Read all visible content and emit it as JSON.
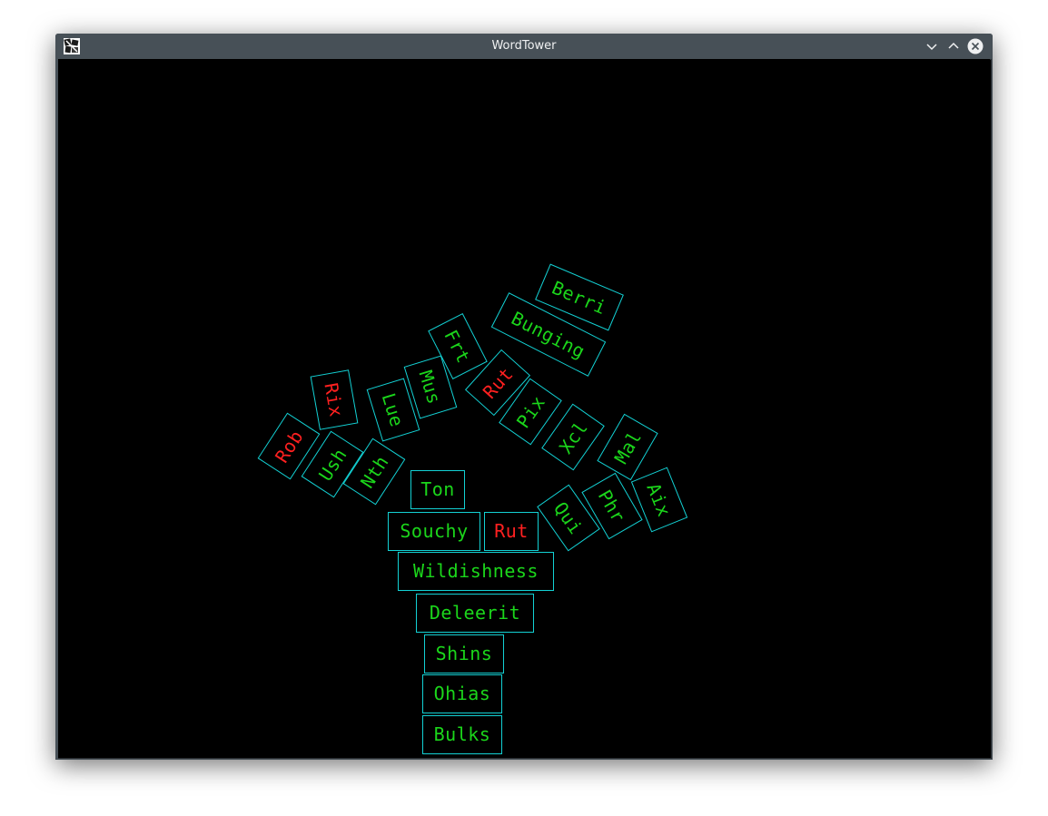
{
  "window": {
    "title": "WordTower",
    "icons": {
      "app": "wordtower-app-icon",
      "minimize": "chevron-down-icon",
      "maximize": "chevron-up-icon",
      "close": "close-icon"
    }
  },
  "colors": {
    "word_text": "#1bd61b",
    "word_text_alert": "#ff2020",
    "block_border": "#13d1d4",
    "canvas_bg": "#000000",
    "titlebar_bg": "#475057"
  },
  "blocks": [
    {
      "word": "Bulks",
      "color": "green",
      "rotation_deg": 0
    },
    {
      "word": "Ohias",
      "color": "green",
      "rotation_deg": 0
    },
    {
      "word": "Shins",
      "color": "green",
      "rotation_deg": 0
    },
    {
      "word": "Deleerit",
      "color": "green",
      "rotation_deg": 0
    },
    {
      "word": "Wildishness",
      "color": "green",
      "rotation_deg": 0
    },
    {
      "word": "Souchy",
      "color": "green",
      "rotation_deg": 0
    },
    {
      "word": "Rut",
      "color": "red",
      "rotation_deg": 0
    },
    {
      "word": "Ton",
      "color": "green",
      "rotation_deg": 0
    },
    {
      "word": "Nth",
      "color": "green",
      "rotation_deg": -57
    },
    {
      "word": "Ush",
      "color": "green",
      "rotation_deg": -57
    },
    {
      "word": "Rob",
      "color": "red",
      "rotation_deg": -57
    },
    {
      "word": "Rix",
      "color": "red",
      "rotation_deg": 80
    },
    {
      "word": "Lue",
      "color": "green",
      "rotation_deg": 73
    },
    {
      "word": "Mus",
      "color": "green",
      "rotation_deg": 73
    },
    {
      "word": "Frt",
      "color": "green",
      "rotation_deg": 63
    },
    {
      "word": "Rut",
      "color": "red",
      "rotation_deg": -48
    },
    {
      "word": "Pix",
      "color": "green",
      "rotation_deg": -55
    },
    {
      "word": "Xcl",
      "color": "green",
      "rotation_deg": -55
    },
    {
      "word": "Mal",
      "color": "green",
      "rotation_deg": -60
    },
    {
      "word": "Qui",
      "color": "green",
      "rotation_deg": 55
    },
    {
      "word": "Phr",
      "color": "green",
      "rotation_deg": 60
    },
    {
      "word": "Aix",
      "color": "green",
      "rotation_deg": 68
    },
    {
      "word": "Bunging",
      "color": "green",
      "rotation_deg": 27
    },
    {
      "word": "Berri",
      "color": "green",
      "rotation_deg": 23
    }
  ]
}
